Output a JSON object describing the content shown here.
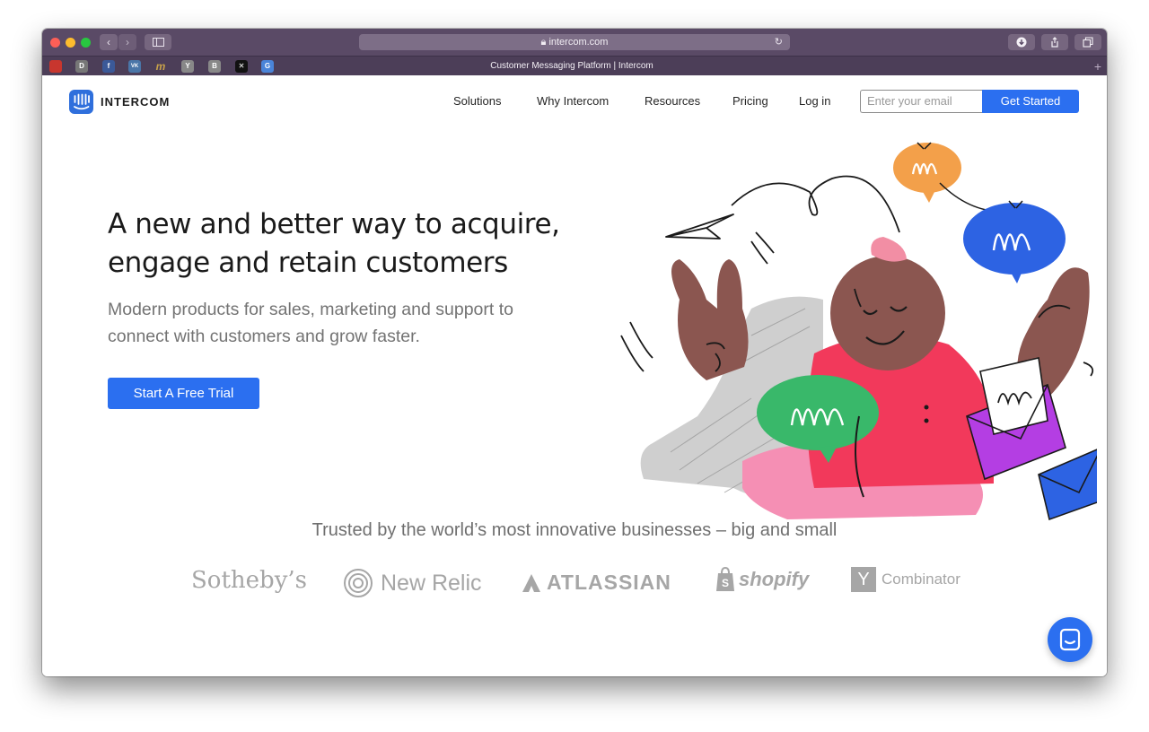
{
  "browser": {
    "url": "intercom.com",
    "tab_title": "Customer Messaging Platform | Intercom",
    "favorites": [
      "D",
      "f",
      "VK",
      "m",
      "Y",
      "B",
      "✕",
      "G"
    ]
  },
  "header": {
    "brand": "INTERCOM",
    "nav": [
      "Solutions",
      "Why Intercom",
      "Resources",
      "Pricing",
      "Log in"
    ],
    "email_placeholder": "Enter your email",
    "cta_label": "Get Started"
  },
  "hero": {
    "headline_line1": "A new and better way to acquire,",
    "headline_line2": "engage and retain customers",
    "subhead_line1": "Modern products for sales, marketing and support to",
    "subhead_line2": "connect with customers and grow faster.",
    "cta_label": "Start A Free Trial"
  },
  "trusted": {
    "heading": "Trusted by the world’s most innovative businesses – big and small",
    "brands": [
      "Sotheby’s",
      "New Relic",
      "ATLASSIAN",
      "shopify",
      "Y",
      "Combinator"
    ]
  },
  "colors": {
    "accent": "#2b6ff0",
    "titlebar": "#5a4a66",
    "tabbar": "#4c3e58"
  }
}
